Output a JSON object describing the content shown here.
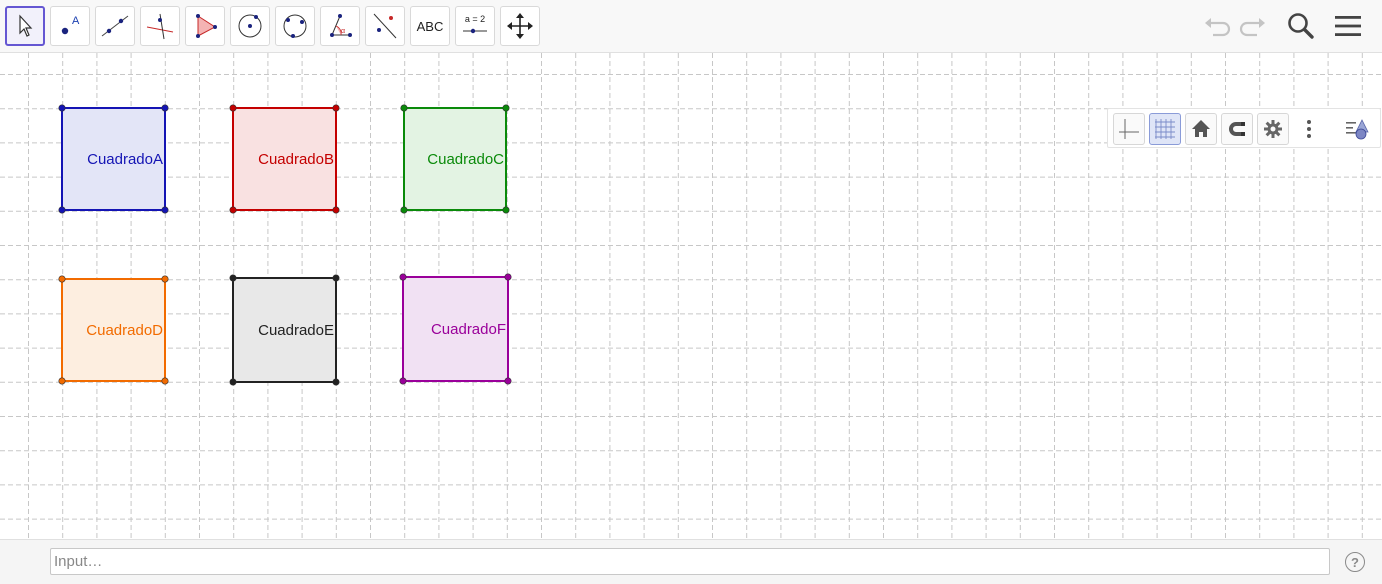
{
  "toolbar": {
    "tools": [
      {
        "name": "move-tool-button",
        "icon": "arrow-cursor-icon",
        "active": true
      },
      {
        "name": "point-tool-button",
        "icon": "point-icon"
      },
      {
        "name": "line-tool-button",
        "icon": "line-icon"
      },
      {
        "name": "perpendicular-tool-button",
        "icon": "perpendicular-icon"
      },
      {
        "name": "polygon-tool-button",
        "icon": "polygon-icon"
      },
      {
        "name": "circle-tool-button",
        "icon": "circle-icon"
      },
      {
        "name": "circle-three-points-tool-button",
        "icon": "circle-three-points-icon"
      },
      {
        "name": "angle-tool-button",
        "icon": "angle-icon"
      },
      {
        "name": "reflect-tool-button",
        "icon": "reflect-icon"
      },
      {
        "name": "text-tool-button",
        "icon": "text-icon",
        "label": "ABC"
      },
      {
        "name": "slider-tool-button",
        "icon": "slider-icon",
        "label": "a = 2"
      },
      {
        "name": "move-view-tool-button",
        "icon": "move-arrows-icon"
      }
    ],
    "right": [
      "undo-icon",
      "redo-icon",
      "search-icon",
      "menu-icon"
    ]
  },
  "stylebar": {
    "buttons": [
      "axes-icon",
      "grid-icon",
      "home-icon",
      "magnet-icon",
      "gear-icon",
      "more-vertical-icon",
      "graphics-style-icon"
    ]
  },
  "graphics": {
    "grid": "dashed",
    "squares": [
      {
        "id": "a",
        "label": "CuadradoA",
        "stroke": "#1414b4",
        "fill": "#e3e5f7"
      },
      {
        "id": "b",
        "label": "CuadradoB",
        "stroke": "#c40000",
        "fill": "#f9e1e1"
      },
      {
        "id": "c",
        "label": "CuadradoC",
        "stroke": "#0a8a0a",
        "fill": "#e3f3e3"
      },
      {
        "id": "d",
        "label": "CuadradoD",
        "stroke": "#f26b00",
        "fill": "#fdeee0"
      },
      {
        "id": "e",
        "label": "CuadradoE",
        "stroke": "#222222",
        "fill": "#e8e8e8"
      },
      {
        "id": "f",
        "label": "CuadradoF",
        "stroke": "#9a009a",
        "fill": "#f1e1f3"
      }
    ]
  },
  "inputbar": {
    "placeholder": "Input…",
    "help": "?"
  }
}
